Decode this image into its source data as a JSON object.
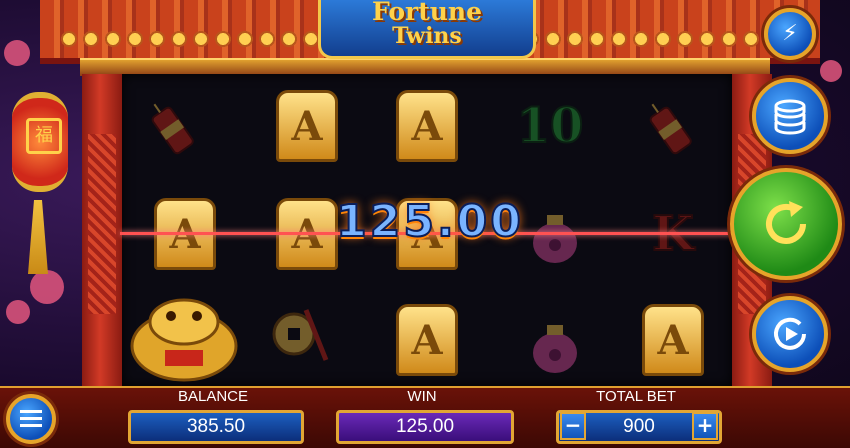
{
  "game": {
    "title_line1": "Fortune",
    "title_line2": "Twins"
  },
  "reels": {
    "rows": [
      [
        "firecracker",
        "A",
        "A",
        "10",
        "firecracker"
      ],
      [
        "A",
        "A",
        "A",
        "pouch",
        "K"
      ],
      [
        "golden-toad",
        "coin-charm",
        "A",
        "pouch",
        "A"
      ]
    ],
    "letters": {
      "r0c1": "A",
      "r0c2": "A",
      "r0c3": "10",
      "r1c0": "A",
      "r1c1": "A",
      "r1c2": "A",
      "r1c4": "K",
      "r2c2": "A",
      "r2c4": "A"
    },
    "win_amount": "125.00",
    "winning_line_row": 2
  },
  "side_buttons": {
    "turbo": "lightning-icon",
    "bet": "coins-icon",
    "spin": "spin-icon",
    "autoplay": "autoplay-icon"
  },
  "bottom_bar": {
    "menu": "menu-icon",
    "balance_label": "BALANCE",
    "balance_value": "385.50",
    "win_label": "WIN",
    "win_value": "125.00",
    "total_bet_label": "TOTAL BET",
    "total_bet_value": "900",
    "minus": "−",
    "plus": "+"
  },
  "colors": {
    "frame_gold": "#e2a634",
    "field_blue": "#1c5fc0",
    "win_purple": "#6a2ab8",
    "spin_green": "#1f8a16",
    "payline_red": "#ff5252"
  }
}
